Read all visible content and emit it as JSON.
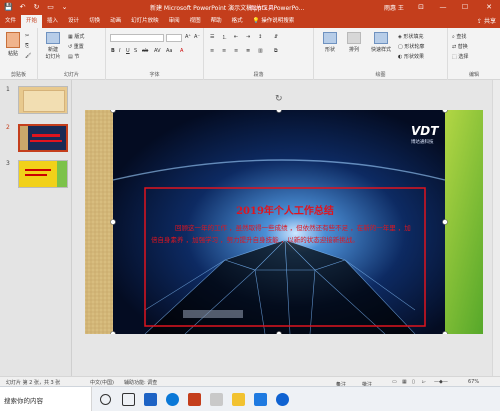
{
  "titlebar": {
    "title": "新建 Microsoft PowerPoint 演示文稿.pptx  -  PowerPo...",
    "context_tool": "图片工具",
    "user": "雨惠 王",
    "minimize": "—",
    "maximize": "☐",
    "close": "✕",
    "accent": "#c43e1c"
  },
  "tabs": [
    "文件",
    "开始",
    "插入",
    "设计",
    "切换",
    "动画",
    "幻灯片放映",
    "审阅",
    "视图",
    "帮助",
    "格式"
  ],
  "active_tab": "开始",
  "tell_me": "操作说明搜索",
  "share": "共享",
  "ribbon": {
    "clipboard": {
      "label": "剪贴板",
      "paste": "粘贴"
    },
    "slides": {
      "label": "幻灯片",
      "new_slide": "新建\n幻灯片",
      "layout": "版式",
      "reset": "重置",
      "section": "节"
    },
    "font": {
      "label": "字体",
      "font_name": "",
      "font_size": ""
    },
    "paragraph": {
      "label": "段落"
    },
    "drawing": {
      "label": "绘图",
      "shapes": "形状",
      "arrange": "排列",
      "quick_styles": "快速样式",
      "fill": "形状填充",
      "outline": "形状轮廓",
      "effects": "形状效果"
    },
    "editing": {
      "label": "编辑",
      "find": "查找",
      "replace": "替换",
      "select": "选择"
    }
  },
  "thumbnails": [
    {
      "num": "1",
      "selected": false
    },
    {
      "num": "2",
      "selected": true
    },
    {
      "num": "3",
      "selected": false
    }
  ],
  "slide": {
    "title": "2019年个人工作总结",
    "body": "回顾这一年的工作 ，虽然取得一些成绩 ，但依然还有些不足 ，在新的一年里 ，加倍自身素养 ，加强学习 ，努力提升自身技能 ，以新的状态迎接新挑战。",
    "logo_text": "VDT",
    "logo_sub": "博达通科技",
    "text_color": "#e0141e"
  },
  "statusbar": {
    "slide_info": "幻灯片 第 2 张，共 3 张",
    "language": "中文(中国)",
    "accessibility": "辅助功能: 调查",
    "notes": "备注",
    "comments": "批注",
    "zoom": "67%"
  },
  "taskbar": {
    "search": "搜索你的内容"
  }
}
